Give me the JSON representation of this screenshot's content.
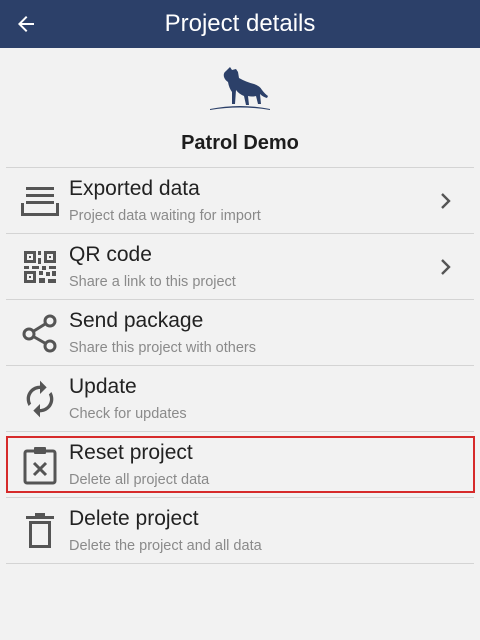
{
  "appbar": {
    "title": "Project details",
    "back_icon": "arrow-left-icon"
  },
  "project": {
    "name": "Patrol Demo",
    "logo_icon": "panther-logo-icon"
  },
  "colors": {
    "appbar_bg": "#2c4069",
    "logo": "#2c4069",
    "highlight": "#d62a2a",
    "icon": "#555555"
  },
  "menu": {
    "items": [
      {
        "title": "Exported data",
        "subtitle": "Project data waiting for import",
        "icon": "tray-icon",
        "has_chevron": true
      },
      {
        "title": "QR code",
        "subtitle": "Share a link to this project",
        "icon": "qr-code-icon",
        "has_chevron": true
      },
      {
        "title": "Send package",
        "subtitle": "Share this project with others",
        "icon": "share-icon",
        "has_chevron": false
      },
      {
        "title": "Update",
        "subtitle": "Check for updates",
        "icon": "refresh-icon",
        "has_chevron": false
      },
      {
        "title": "Reset project",
        "subtitle": "Delete all project data",
        "icon": "clipboard-x-icon",
        "has_chevron": false
      },
      {
        "title": "Delete project",
        "subtitle": "Delete the project and all data",
        "icon": "trash-icon",
        "has_chevron": false
      }
    ]
  }
}
